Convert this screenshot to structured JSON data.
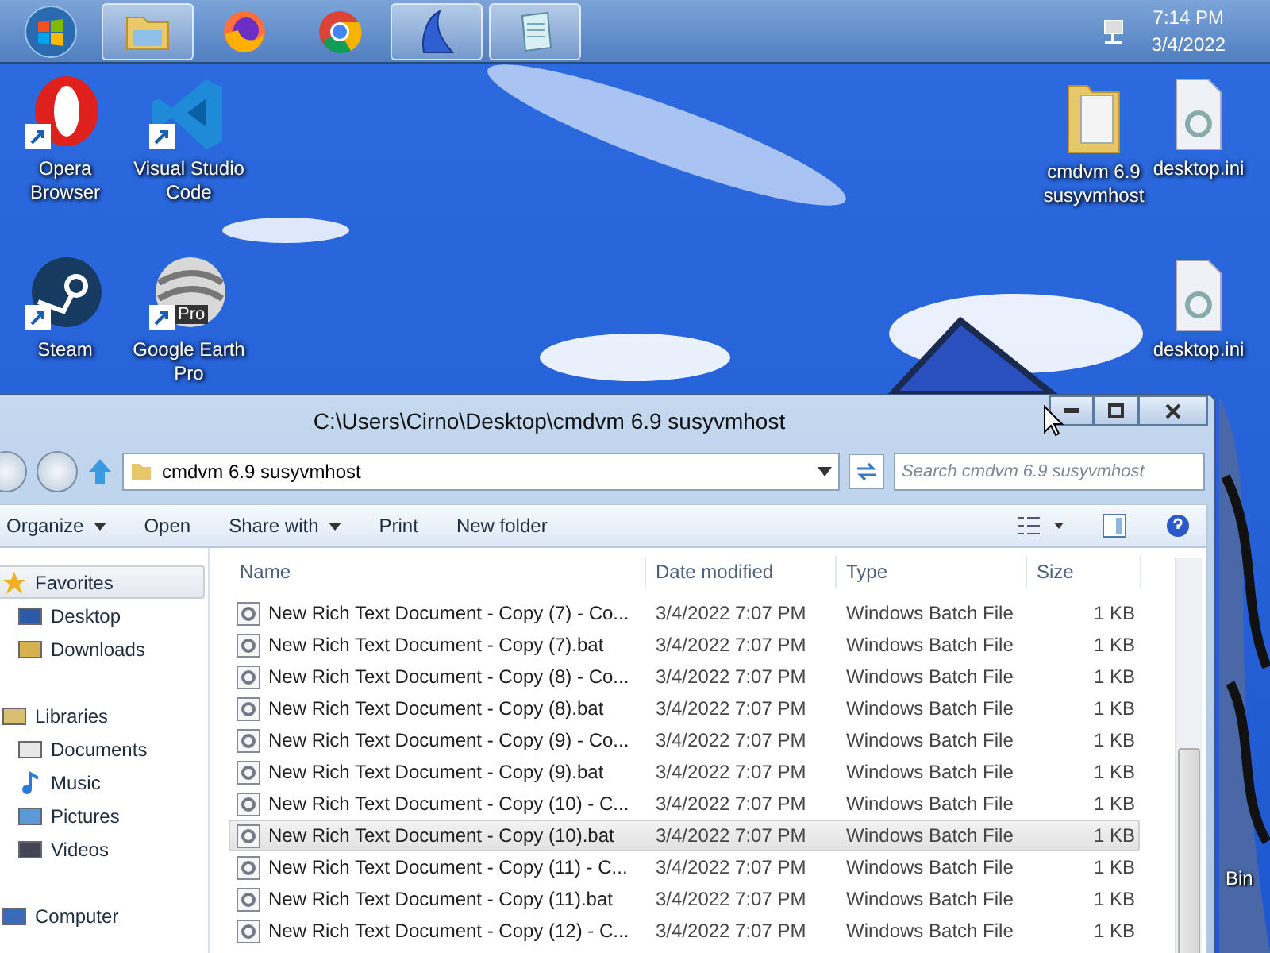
{
  "taskbar": {
    "items": [
      {
        "kind": "start",
        "active": false
      },
      {
        "kind": "folder",
        "active": true
      },
      {
        "kind": "firefox",
        "active": false
      },
      {
        "kind": "chrome",
        "active": false
      },
      {
        "kind": "shark",
        "active": true
      },
      {
        "kind": "notepad",
        "active": true
      }
    ],
    "time": "7:14 PM",
    "date": "3/4/2022"
  },
  "desktop": {
    "left_icons": [
      {
        "kind": "opera",
        "label": "Opera Browser"
      },
      {
        "kind": "steam",
        "label": "Steam"
      },
      {
        "kind": "vscode",
        "label": "Visual Studio Code"
      },
      {
        "kind": "earth",
        "label": "Google Earth Pro",
        "badge": "Pro"
      }
    ],
    "right_icons": [
      {
        "kind": "folder",
        "label": "cmdvm 6.9 susyvmhost"
      },
      {
        "kind": "ini",
        "label": "desktop.ini"
      },
      {
        "kind": "ini",
        "label": "desktop.ini"
      }
    ],
    "edge_label": "Bin"
  },
  "window": {
    "title": "C:\\Users\\Cirno\\Desktop\\cmdvm 6.9 susyvmhost",
    "address": "cmdvm 6.9 susyvmhost",
    "search": {
      "placeholder": "Search cmdvm 6.9 susyvmhost"
    },
    "commands": [
      {
        "label": "Organize",
        "dropdown": true
      },
      {
        "label": "Open",
        "dropdown": false
      },
      {
        "label": "Share with",
        "dropdown": true
      },
      {
        "label": "Print",
        "dropdown": false
      },
      {
        "label": "New folder",
        "dropdown": false
      }
    ],
    "nav": [
      {
        "kind": "favorites",
        "label": "Favorites",
        "selected": true,
        "children": [
          {
            "kind": "desktop",
            "label": "Desktop",
            "selected": false
          },
          {
            "kind": "downloads",
            "label": "Downloads",
            "selected": false
          }
        ]
      },
      {
        "kind": "libraries",
        "label": "Libraries",
        "selected": false,
        "children": [
          {
            "kind": "documents",
            "label": "Documents",
            "selected": false
          },
          {
            "kind": "music",
            "label": "Music",
            "selected": false
          },
          {
            "kind": "pictures",
            "label": "Pictures",
            "selected": false
          },
          {
            "kind": "videos",
            "label": "Videos",
            "selected": false
          }
        ]
      },
      {
        "kind": "computer",
        "label": "Computer",
        "selected": false
      }
    ],
    "columns": [
      "Name",
      "Date modified",
      "Type",
      "Size"
    ],
    "rows": [
      {
        "name": "New Rich Text Document - Copy (7) - Co...",
        "date": "3/4/2022 7:07 PM",
        "type": "Windows Batch File",
        "size": "1 KB",
        "selected": false
      },
      {
        "name": "New Rich Text Document - Copy (7).bat",
        "date": "3/4/2022 7:07 PM",
        "type": "Windows Batch File",
        "size": "1 KB",
        "selected": false
      },
      {
        "name": "New Rich Text Document - Copy (8) - Co...",
        "date": "3/4/2022 7:07 PM",
        "type": "Windows Batch File",
        "size": "1 KB",
        "selected": false
      },
      {
        "name": "New Rich Text Document - Copy (8).bat",
        "date": "3/4/2022 7:07 PM",
        "type": "Windows Batch File",
        "size": "1 KB",
        "selected": false
      },
      {
        "name": "New Rich Text Document - Copy (9) - Co...",
        "date": "3/4/2022 7:07 PM",
        "type": "Windows Batch File",
        "size": "1 KB",
        "selected": false
      },
      {
        "name": "New Rich Text Document - Copy (9).bat",
        "date": "3/4/2022 7:07 PM",
        "type": "Windows Batch File",
        "size": "1 KB",
        "selected": false
      },
      {
        "name": "New Rich Text Document - Copy (10) - C...",
        "date": "3/4/2022 7:07 PM",
        "type": "Windows Batch File",
        "size": "1 KB",
        "selected": false
      },
      {
        "name": "New Rich Text Document - Copy (10).bat",
        "date": "3/4/2022 7:07 PM",
        "type": "Windows Batch File",
        "size": "1 KB",
        "selected": true
      },
      {
        "name": "New Rich Text Document - Copy (11) - C...",
        "date": "3/4/2022 7:07 PM",
        "type": "Windows Batch File",
        "size": "1 KB",
        "selected": false
      },
      {
        "name": "New Rich Text Document - Copy (11).bat",
        "date": "3/4/2022 7:07 PM",
        "type": "Windows Batch File",
        "size": "1 KB",
        "selected": false
      },
      {
        "name": "New Rich Text Document - Copy (12) - C...",
        "date": "3/4/2022 7:07 PM",
        "type": "Windows Batch File",
        "size": "1 KB",
        "selected": false
      }
    ]
  }
}
